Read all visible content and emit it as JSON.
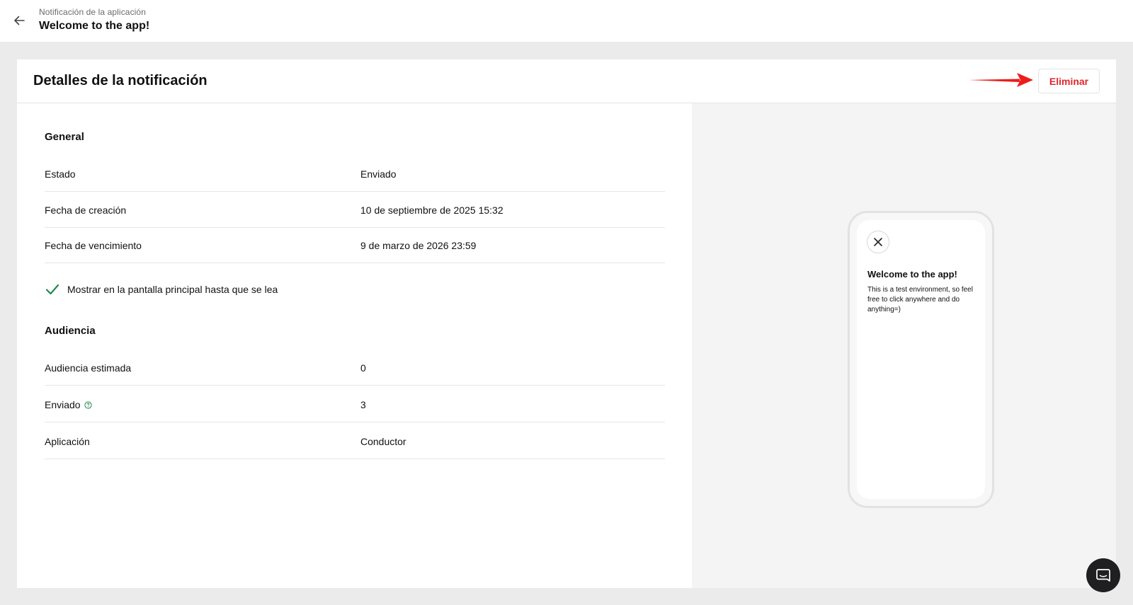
{
  "header": {
    "breadcrumb": "Notificación de la aplicación",
    "title": "Welcome to the app!",
    "back_icon": "arrow-left-icon"
  },
  "card": {
    "title": "Detalles de la notificación",
    "delete_label": "Eliminar",
    "accent_color": "#e0262f"
  },
  "general": {
    "section_title": "General",
    "rows": [
      {
        "label": "Estado",
        "value": "Enviado"
      },
      {
        "label": "Fecha de creación",
        "value": "10 de septiembre de 2025 15:32"
      },
      {
        "label": "Fecha de vencimiento",
        "value": "9 de marzo de 2026 23:59"
      }
    ],
    "checkbox_label": "Mostrar en la pantalla principal hasta que se lea",
    "checkbox_checked": true
  },
  "audience": {
    "section_title": "Audiencia",
    "rows": [
      {
        "label": "Audiencia estimada",
        "value": "0"
      },
      {
        "label": "Enviado",
        "value": "3",
        "help_icon": "help-circle-icon"
      },
      {
        "label": "Aplicación",
        "value": "Conductor"
      }
    ]
  },
  "preview": {
    "title": "Welcome to the app!",
    "body": "This is a test environment, so feel free to click anywhere and do anything=)",
    "close_icon": "close-icon"
  },
  "chat": {
    "icon": "chat-icon"
  }
}
